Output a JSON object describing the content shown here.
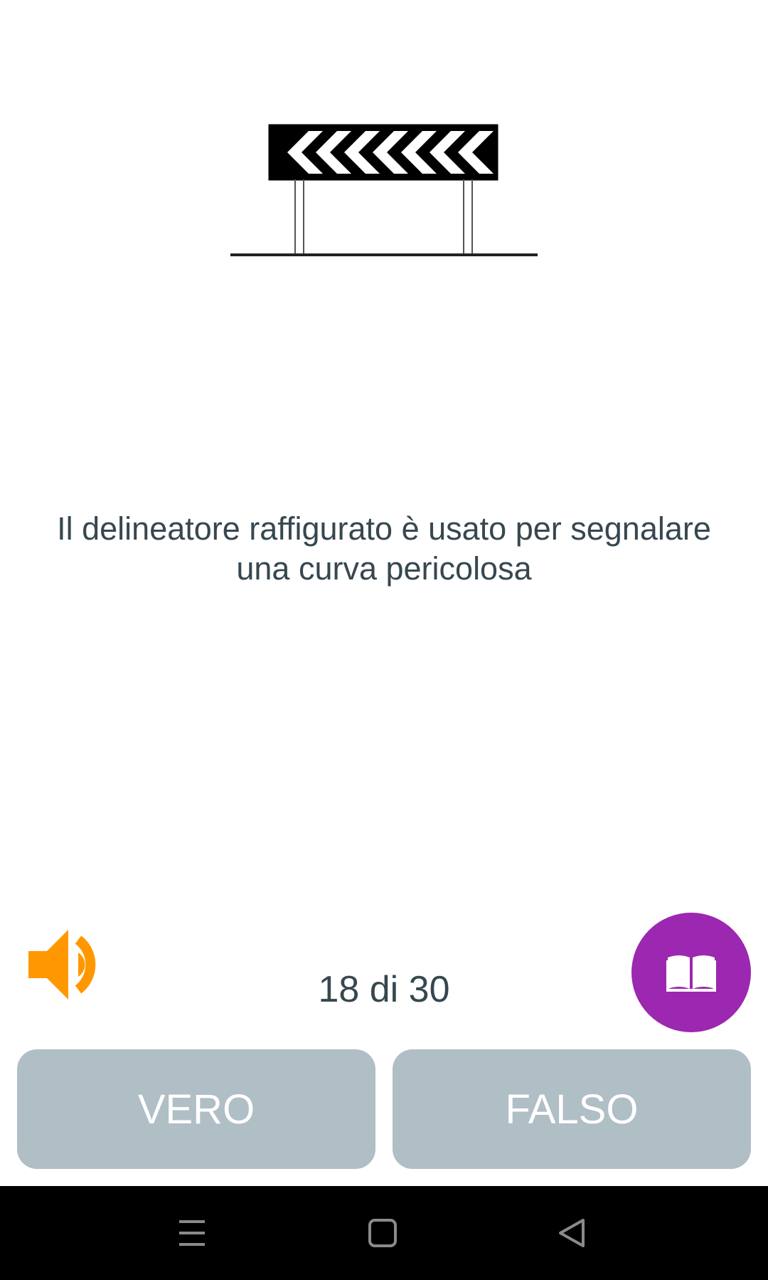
{
  "question": {
    "text": "Il delineatore raffigurato è usato per segnalare una curva pericolosa",
    "image_icon": "chevron-delineator-sign"
  },
  "progress": {
    "current": 18,
    "total": 30,
    "label": "18 di 30"
  },
  "controls": {
    "audio_icon": "speaker-icon",
    "audio_color": "#ff9800",
    "theory_icon": "book-icon",
    "theory_color": "#9c27b0"
  },
  "answers": {
    "true_label": "VERO",
    "false_label": "FALSO",
    "button_color": "#b0bec5"
  },
  "system_nav": {
    "items": [
      "menu-icon",
      "home-icon",
      "back-icon"
    ]
  }
}
